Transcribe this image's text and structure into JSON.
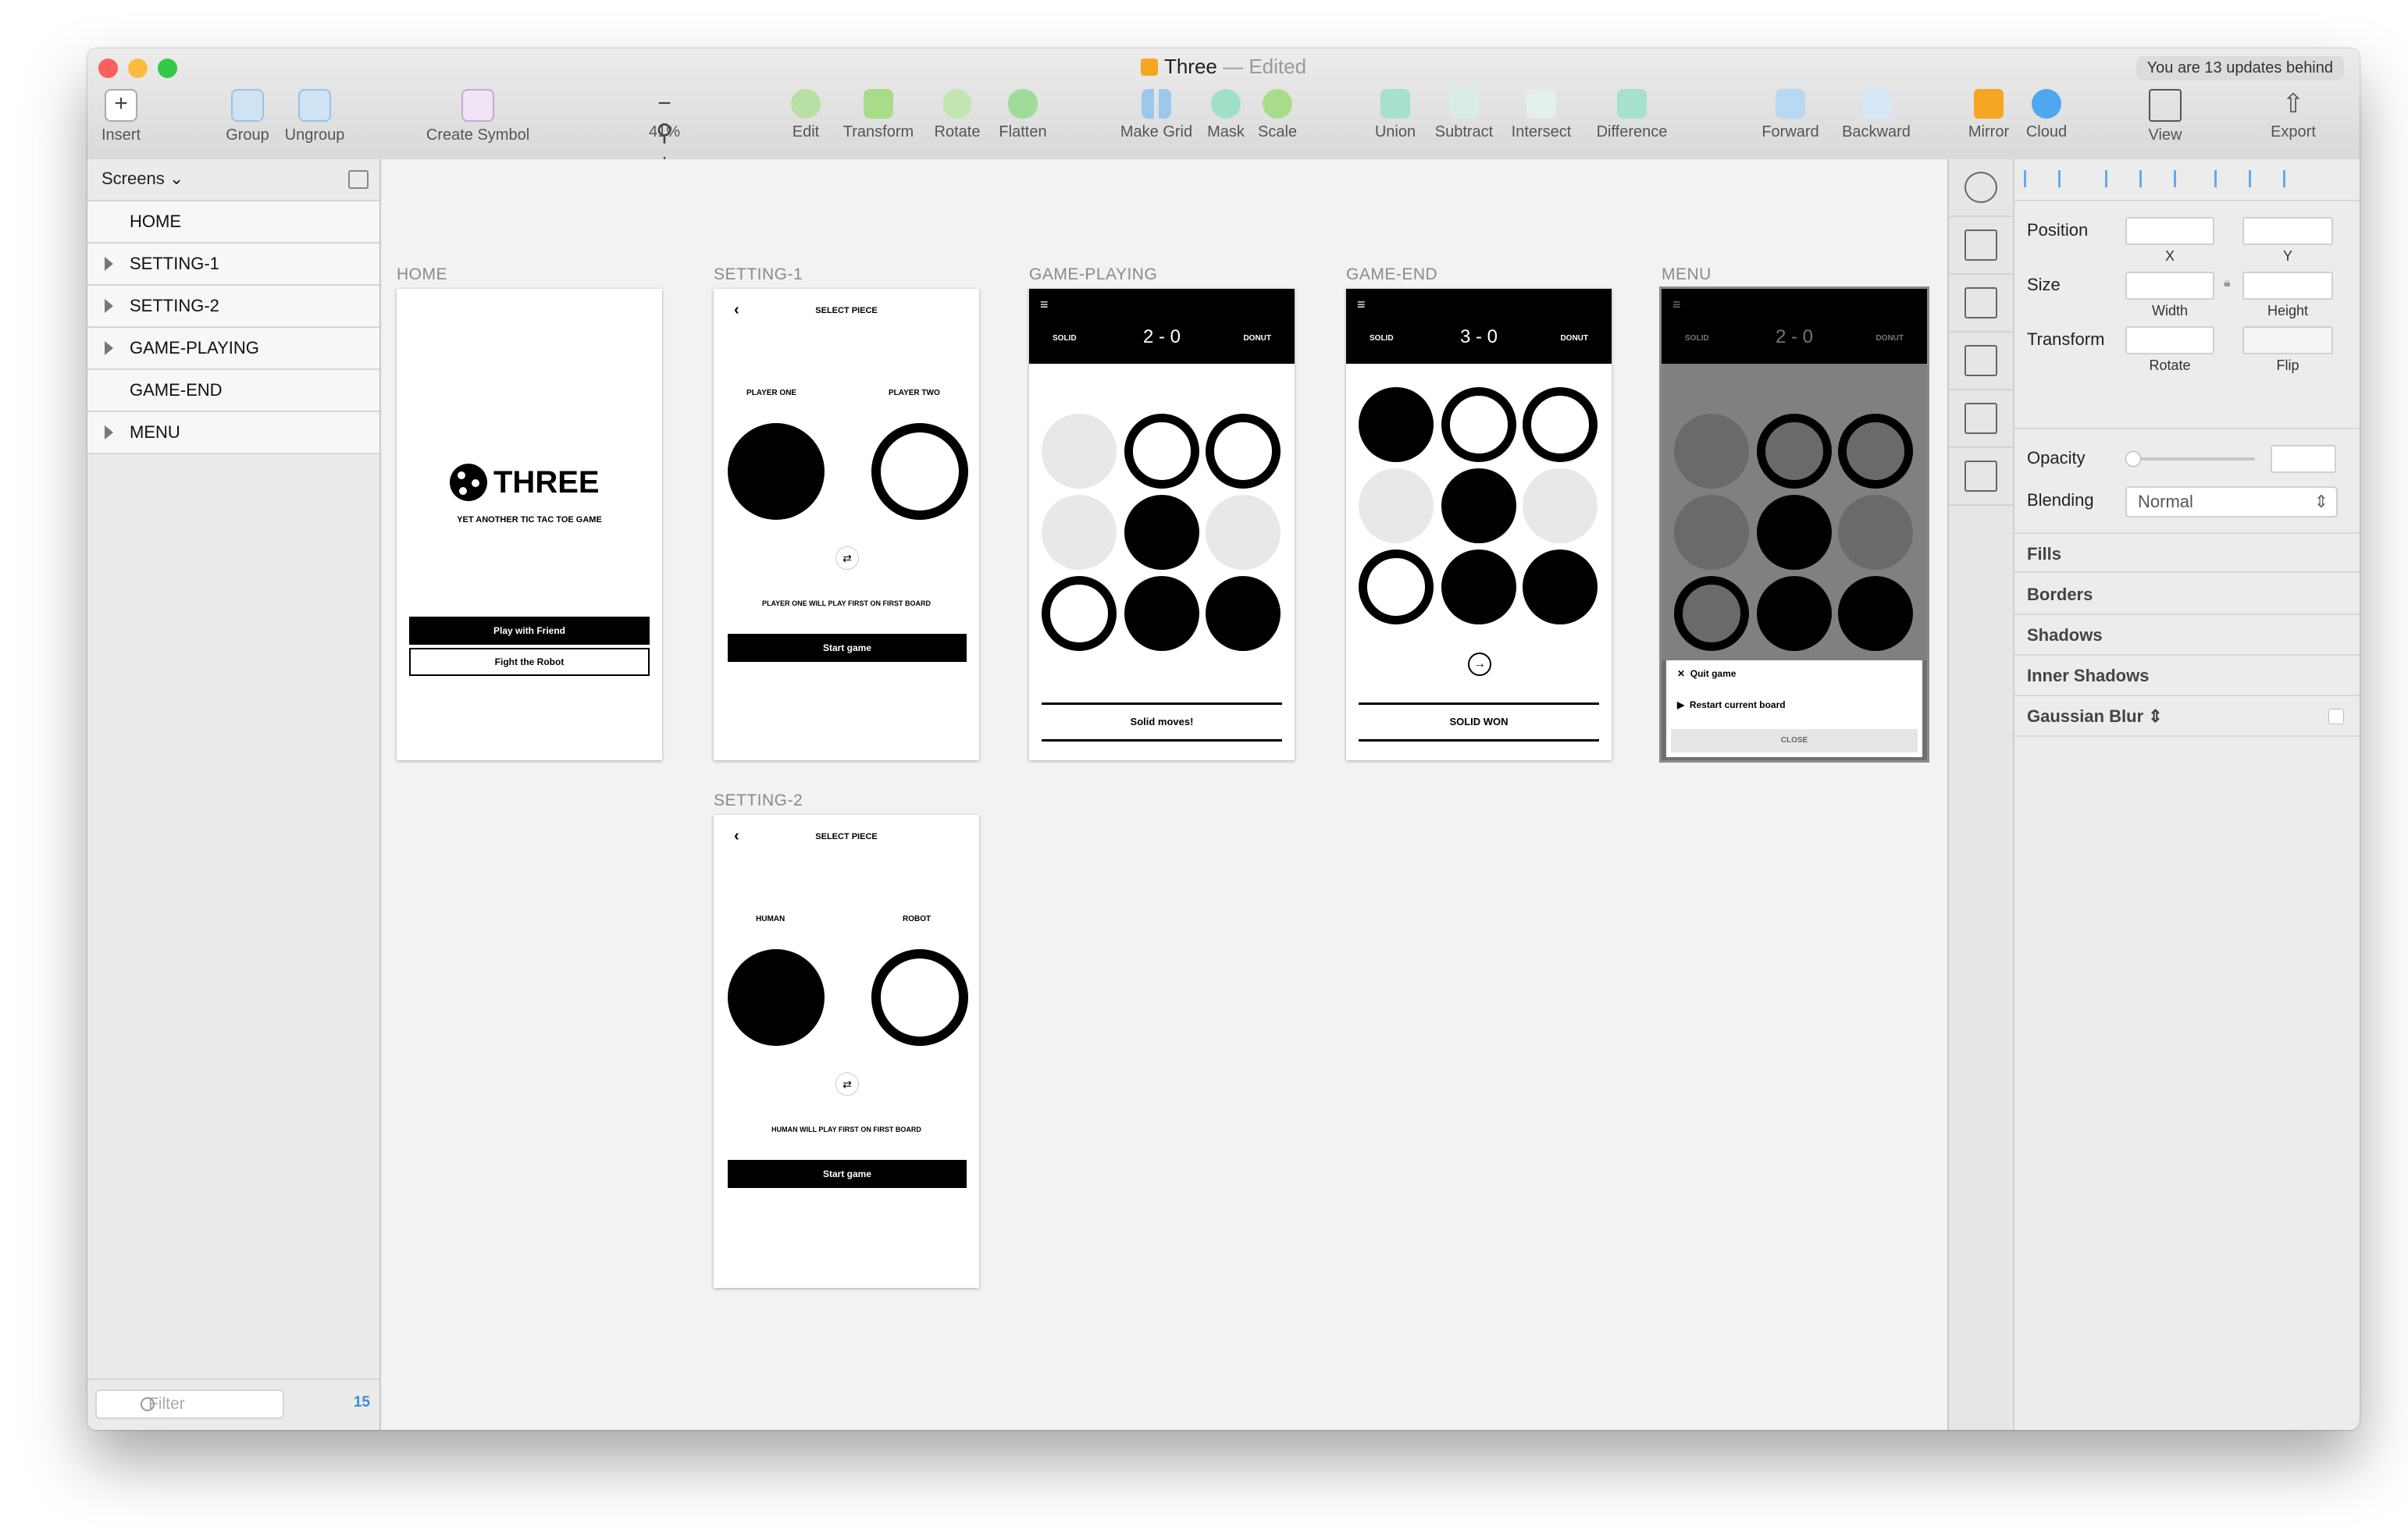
{
  "window": {
    "title": "Three",
    "edited_label": "— Edited",
    "updates": "You are 13 updates behind"
  },
  "toolbar": {
    "insert": "Insert",
    "group": "Group",
    "ungroup": "Ungroup",
    "create_symbol": "Create Symbol",
    "zoom": "41%",
    "edit": "Edit",
    "transform": "Transform",
    "rotate": "Rotate",
    "flatten": "Flatten",
    "make_grid": "Make Grid",
    "mask": "Mask",
    "scale": "Scale",
    "union": "Union",
    "subtract": "Subtract",
    "intersect": "Intersect",
    "difference": "Difference",
    "forward": "Forward",
    "backward": "Backward",
    "mirror": "Mirror",
    "cloud": "Cloud",
    "view": "View",
    "export": "Export"
  },
  "sidebar": {
    "header": "Screens",
    "pages": [
      "HOME",
      "SETTING-1",
      "SETTING-2",
      "GAME-PLAYING",
      "GAME-END",
      "MENU"
    ],
    "filter_placeholder": "Filter",
    "count": "15"
  },
  "artboards": {
    "home": {
      "label": "HOME",
      "logo": "THREE",
      "subtitle": "YET ANOTHER TIC TAC TOE GAME",
      "btn_friend": "Play with Friend",
      "btn_robot": "Fight the Robot"
    },
    "setting1": {
      "label": "SETTING-1",
      "header": "SELECT PIECE",
      "left": "PLAYER ONE",
      "right": "PLAYER TWO",
      "info": "PLAYER ONE WILL PLAY FIRST ON FIRST BOARD",
      "start": "Start game"
    },
    "setting2": {
      "label": "SETTING-2",
      "header": "SELECT PIECE",
      "left": "HUMAN",
      "right": "ROBOT",
      "info": "HUMAN WILL PLAY FIRST ON FIRST BOARD",
      "start": "Start game"
    },
    "playing": {
      "label": "GAME-PLAYING",
      "left": "SOLID",
      "score": "2 - 0",
      "right": "DONUT",
      "status": "Solid moves!"
    },
    "end": {
      "label": "GAME-END",
      "left": "SOLID",
      "score": "3 - 0",
      "right": "DONUT",
      "status": "SOLID WON"
    },
    "menu": {
      "label": "MENU",
      "left": "SOLID",
      "score": "2 - 0",
      "right": "DONUT",
      "quit": "Quit game",
      "restart": "Restart current board",
      "close": "CLOSE"
    }
  },
  "inspector": {
    "position": "Position",
    "x": "X",
    "y": "Y",
    "size": "Size",
    "width": "Width",
    "height": "Height",
    "transform": "Transform",
    "rotate": "Rotate",
    "flip": "Flip",
    "opacity": "Opacity",
    "blending": "Blending",
    "blending_value": "Normal",
    "fills": "Fills",
    "borders": "Borders",
    "shadows": "Shadows",
    "inner_shadows": "Inner Shadows",
    "gaussian_blur": "Gaussian Blur"
  },
  "colors": {
    "close": "#fc605c",
    "minimize": "#fdbc40",
    "zoom": "#34c84a",
    "accent": "#3a8bd8"
  }
}
